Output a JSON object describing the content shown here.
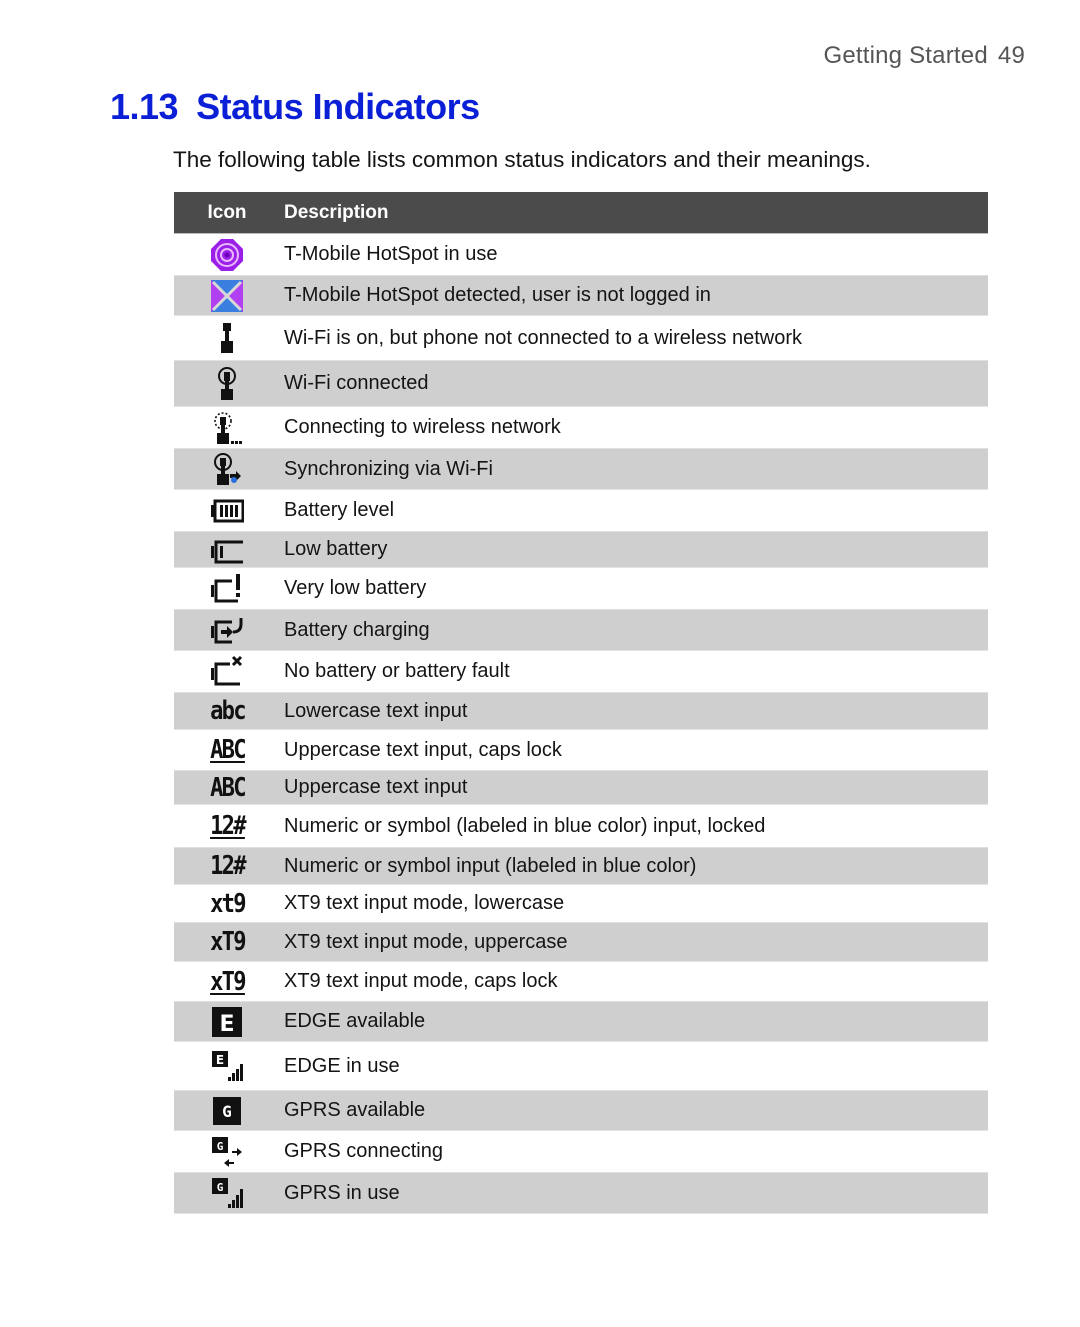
{
  "running_header": {
    "section": "Getting Started",
    "page_number": "49"
  },
  "section": {
    "number": "1.13",
    "title": "Status Indicators"
  },
  "intro": "The following table lists common status indicators and their meanings.",
  "table": {
    "columns": [
      "Icon",
      "Description"
    ],
    "header_bg": "#4b4b4b",
    "shade_color": "#cfcfcf",
    "rows": [
      {
        "icon": "tmobile-hotspot-in-use-icon",
        "description": "T-Mobile HotSpot in use"
      },
      {
        "icon": "tmobile-hotspot-not-logged-in-icon",
        "description": "T-Mobile HotSpot detected, user is not logged in"
      },
      {
        "icon": "wifi-on-not-connected-icon",
        "description": "Wi-Fi is on, but phone not connected to a wireless network"
      },
      {
        "icon": "wifi-connected-icon",
        "description": "Wi-Fi connected"
      },
      {
        "icon": "wifi-connecting-icon",
        "description": "Connecting to wireless network"
      },
      {
        "icon": "wifi-sync-icon",
        "description": "Synchronizing via Wi-Fi"
      },
      {
        "icon": "battery-level-icon",
        "description": "Battery level"
      },
      {
        "icon": "battery-low-icon",
        "description": "Low battery"
      },
      {
        "icon": "battery-very-low-icon",
        "description": "Very low battery"
      },
      {
        "icon": "battery-charging-icon",
        "description": "Battery charging"
      },
      {
        "icon": "battery-fault-icon",
        "description": "No battery or battery fault"
      },
      {
        "icon": "lowercase-input-icon",
        "glyph": "abc",
        "description": "Lowercase text input"
      },
      {
        "icon": "uppercase-capslock-icon",
        "glyph": "ABC",
        "description": "Uppercase text input, caps lock"
      },
      {
        "icon": "uppercase-input-icon",
        "glyph": "ABC",
        "description": "Uppercase text input"
      },
      {
        "icon": "numeric-locked-icon",
        "glyph": "12#",
        "description": "Numeric or symbol (labeled in blue color) input, locked"
      },
      {
        "icon": "numeric-input-icon",
        "glyph": "12#",
        "description": "Numeric or symbol input (labeled in blue color)"
      },
      {
        "icon": "xt9-lowercase-icon",
        "glyph": "xt9",
        "description": "XT9 text input mode, lowercase"
      },
      {
        "icon": "xt9-uppercase-icon",
        "glyph": "xT9",
        "description": "XT9 text input mode, uppercase"
      },
      {
        "icon": "xt9-capslock-icon",
        "glyph": "xT9",
        "description": "XT9 text input mode, caps lock"
      },
      {
        "icon": "edge-available-icon",
        "glyph": "E",
        "description": "EDGE available"
      },
      {
        "icon": "edge-in-use-icon",
        "glyph": "E",
        "description": "EDGE in use"
      },
      {
        "icon": "gprs-available-icon",
        "glyph": "G",
        "description": "GPRS available"
      },
      {
        "icon": "gprs-connecting-icon",
        "glyph": "G",
        "description": "GPRS connecting"
      },
      {
        "icon": "gprs-in-use-icon",
        "glyph": "G",
        "description": "GPRS in use"
      }
    ]
  }
}
